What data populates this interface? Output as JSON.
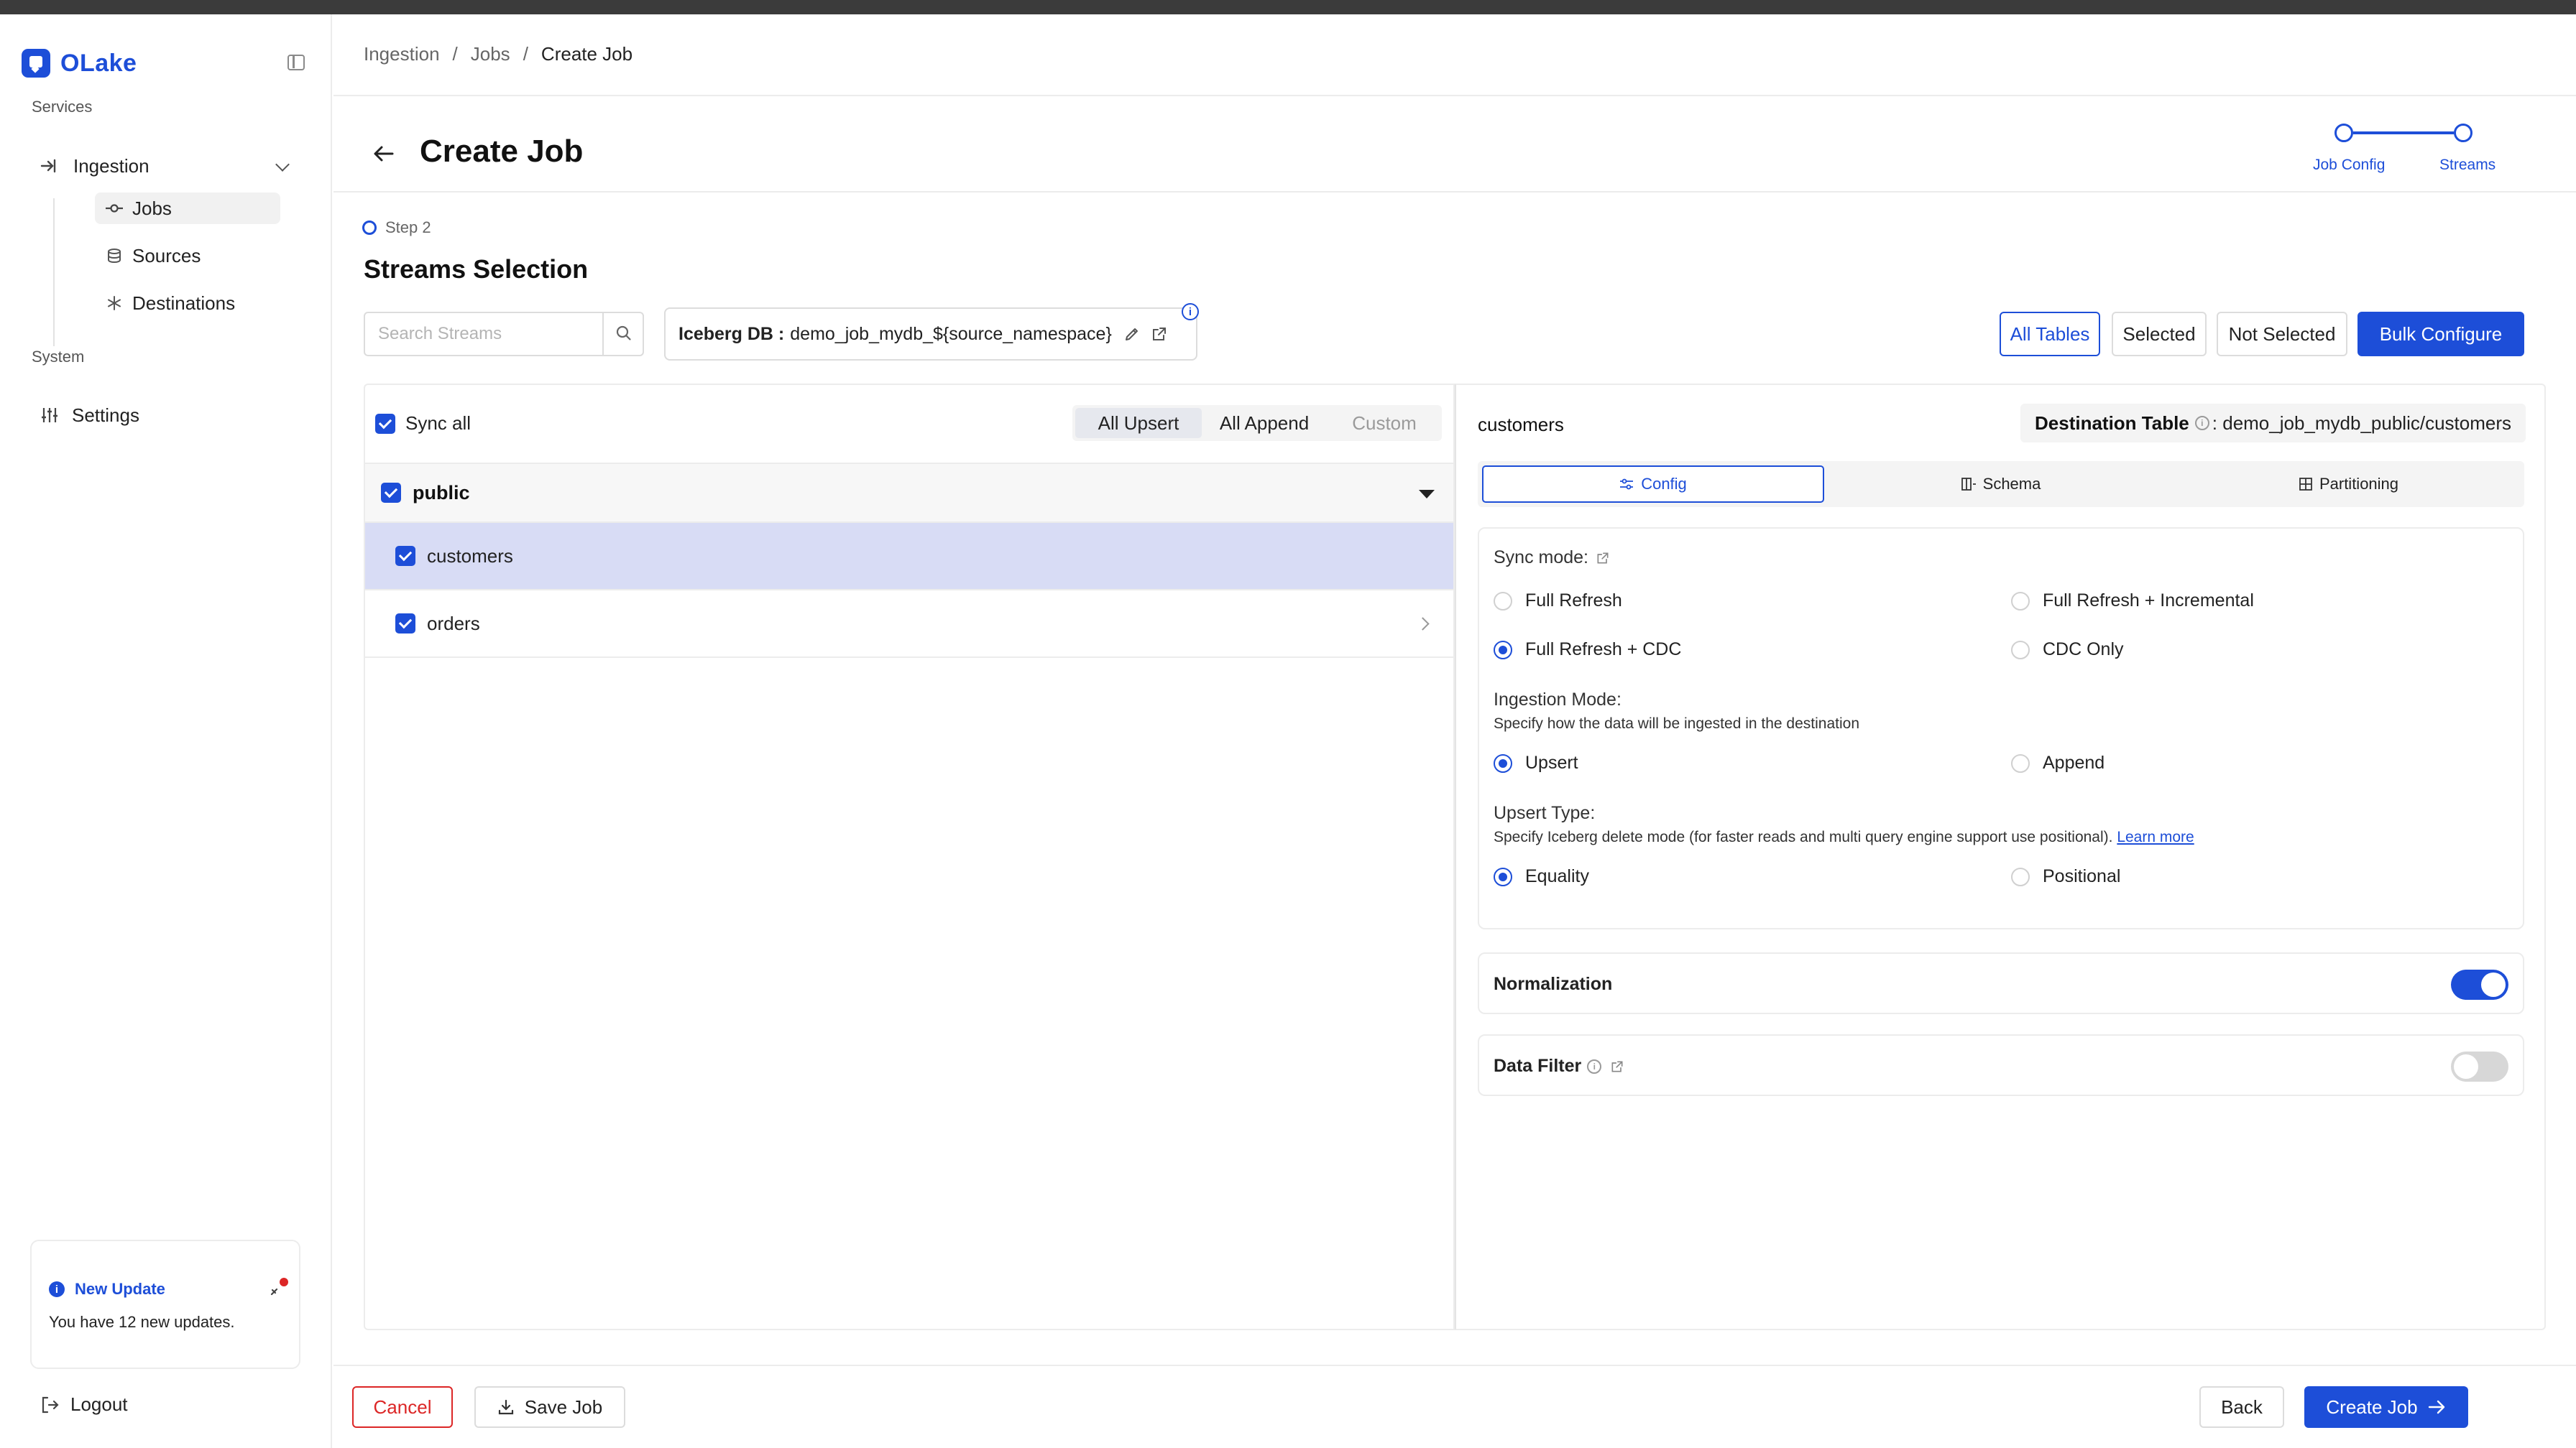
{
  "app": {
    "name": "OLake"
  },
  "sidebar": {
    "services_label": "Services",
    "ingestion_label": "Ingestion",
    "items": [
      {
        "label": "Jobs",
        "icon": "commit-icon",
        "active": true
      },
      {
        "label": "Sources",
        "icon": "database-icon",
        "active": false
      },
      {
        "label": "Destinations",
        "icon": "asterisk-icon",
        "active": false
      }
    ],
    "system_label": "System",
    "settings_label": "Settings",
    "update": {
      "title": "New Update",
      "description": "You have 12 new updates."
    },
    "logout_label": "Logout"
  },
  "breadcrumb": {
    "items": [
      "Ingestion",
      "Jobs",
      "Create Job"
    ],
    "separator": "/"
  },
  "header": {
    "title": "Create Job",
    "steps": [
      {
        "label": "Job Config"
      },
      {
        "label": "Streams"
      }
    ]
  },
  "step": {
    "tag": "Step 2",
    "title": "Streams Selection"
  },
  "toolbar": {
    "search_placeholder": "Search Streams",
    "iceberg_key": "Iceberg DB :",
    "iceberg_value": "demo_job_mydb_${source_namespace}",
    "filters": [
      "All Tables",
      "Selected",
      "Not Selected"
    ],
    "active_filter": "All Tables",
    "bulk_configure": "Bulk Configure"
  },
  "streams": {
    "sync_all_label": "Sync all",
    "modes": [
      "All Upsert",
      "All Append",
      "Custom"
    ],
    "active_mode": "All Upsert",
    "namespace": "public",
    "rows": [
      {
        "name": "customers",
        "checked": true,
        "selected": true
      },
      {
        "name": "orders",
        "checked": true,
        "selected": false
      }
    ]
  },
  "detail": {
    "stream_name": "customers",
    "destination_key": "Destination Table",
    "destination_value": ": demo_job_mydb_public/customers",
    "tabs": [
      "Config",
      "Schema",
      "Partitioning"
    ],
    "active_tab": "Config",
    "sync_mode_label": "Sync mode:",
    "sync_modes": [
      "Full Refresh",
      "Full Refresh + Incremental",
      "Full Refresh + CDC",
      "CDC Only"
    ],
    "selected_sync_mode": "Full Refresh + CDC",
    "ingestion_mode_label": "Ingestion Mode:",
    "ingestion_mode_desc": "Specify how the data will be ingested in the destination",
    "ingestion_modes": [
      "Upsert",
      "Append"
    ],
    "selected_ingestion_mode": "Upsert",
    "upsert_type_label": "Upsert Type:",
    "upsert_type_desc": "Specify Iceberg delete mode (for faster reads and multi query engine support use positional).",
    "learn_more": "Learn more",
    "upsert_types": [
      "Equality",
      "Positional"
    ],
    "selected_upsert_type": "Equality",
    "normalization_label": "Normalization",
    "normalization_on": true,
    "data_filter_label": "Data Filter",
    "data_filter_on": false
  },
  "footer": {
    "cancel": "Cancel",
    "save": "Save Job",
    "back": "Back",
    "create": "Create Job"
  },
  "colors": {
    "accent": "#1d4ed8",
    "danger": "#dc2626",
    "selected_row": "#d8dcf5"
  }
}
